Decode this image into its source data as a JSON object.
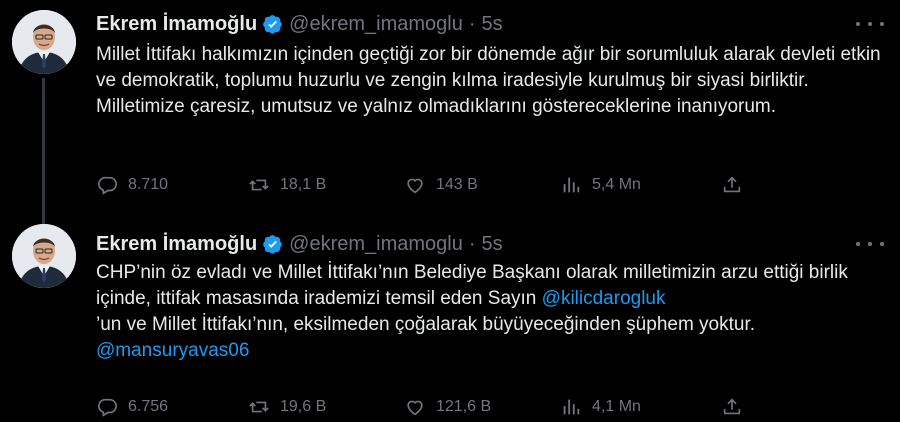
{
  "tweets": [
    {
      "author": "Ekrem İmamoğlu",
      "handle": "@ekrem_imamoglu",
      "time": "5s",
      "text": "Millet İttifakı halkımızın içinden geçtiği zor bir dönemde ağır bir sorumluluk alarak devleti etkin ve demokratik, toplumu huzurlu ve zengin kılma iradesiyle kurulmuş bir siyasi birliktir. Milletimize çaresiz, umutsuz ve yalnız olmadıklarını göstereceklerine inanıyorum.",
      "replies": "8.710",
      "retweets": "18,1 B",
      "likes": "143 B",
      "views": "5,4 Mn"
    },
    {
      "author": "Ekrem İmamoğlu",
      "handle": "@ekrem_imamoglu",
      "time": "5s",
      "text_part1": "CHP’nin öz evladı ve Millet İttifakı’nın Belediye Başkanı olarak milletimizin arzu ettiği birlik içinde, ittifak masasında irademizi temsil eden Sayın ",
      "mention1": "@kilicdarogluk",
      "text_part2": " ’un ve Millet İttifakı’nın, eksilmeden çoğalarak büyüyeceğinden şüphem yoktur.",
      "mention2": "@mansuryavas06",
      "replies": "6.756",
      "retweets": "19,6 B",
      "likes": "121,6 B",
      "views": "4,1 Mn"
    }
  ],
  "colors": {
    "background": "#000000",
    "text": "#e7e9ea",
    "muted": "#71767b",
    "accent": "#1d9bf0"
  },
  "icons": [
    "avatar",
    "verified-badge-icon",
    "more-icon",
    "reply-icon",
    "retweet-icon",
    "like-icon",
    "views-icon",
    "share-icon"
  ]
}
